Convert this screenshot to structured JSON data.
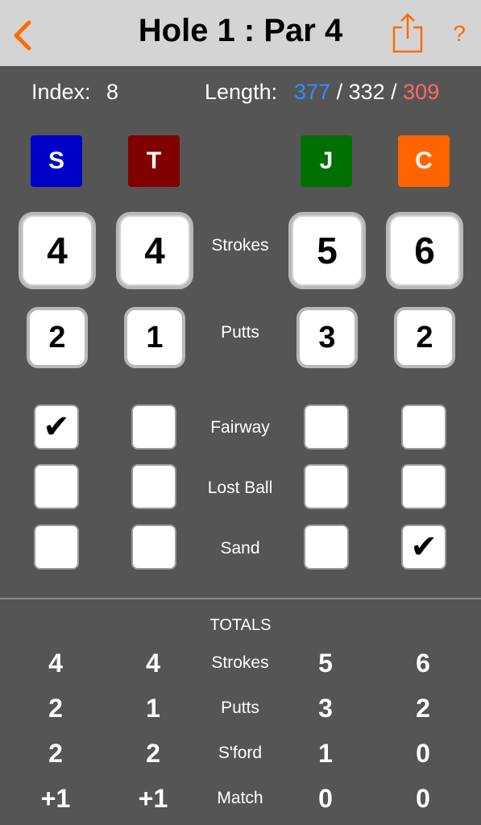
{
  "header": {
    "title": "Hole 1 : Par 4",
    "help": "?",
    "accent_color": "#ff6a00"
  },
  "info": {
    "index_label": "Index:",
    "index_value": "8",
    "length_label": "Length:",
    "length_blue": "377",
    "length_sep1": " / ",
    "length_white": "332",
    "length_sep2": " / ",
    "length_red": "309",
    "colors": {
      "blue": "#2f8fff",
      "red": "#ff6b6b"
    }
  },
  "players": [
    {
      "initial": "S",
      "color": "#0000c8",
      "strokes": "4",
      "putts": "2",
      "fairway": "✔",
      "lost_ball": "",
      "sand": ""
    },
    {
      "initial": "T",
      "color": "#800000",
      "strokes": "4",
      "putts": "1",
      "fairway": "",
      "lost_ball": "",
      "sand": ""
    },
    {
      "initial": "J",
      "color": "#007000",
      "strokes": "5",
      "putts": "3",
      "fairway": "",
      "lost_ball": "",
      "sand": ""
    },
    {
      "initial": "C",
      "color": "#ff6400",
      "strokes": "6",
      "putts": "2",
      "fairway": "",
      "lost_ball": "",
      "sand": "✔"
    }
  ],
  "labels": {
    "strokes": "Strokes",
    "putts": "Putts",
    "fairway": "Fairway",
    "lost_ball": "Lost Ball",
    "sand": "Sand"
  },
  "totals": {
    "title": "TOTALS",
    "rows": [
      {
        "label": "Strokes",
        "values": [
          "4",
          "4",
          "5",
          "6"
        ]
      },
      {
        "label": "Putts",
        "values": [
          "2",
          "1",
          "3",
          "2"
        ]
      },
      {
        "label": "S'ford",
        "values": [
          "2",
          "2",
          "1",
          "0"
        ]
      },
      {
        "label": "Match",
        "values": [
          "+1",
          "+1",
          "0",
          "0"
        ]
      }
    ]
  }
}
